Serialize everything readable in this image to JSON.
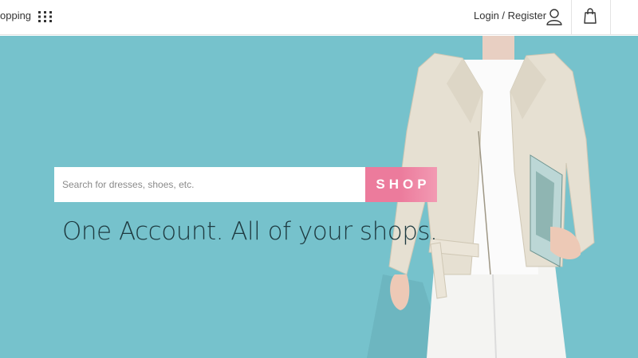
{
  "header": {
    "nav_label": "opping",
    "nav_icon": "grid-icon",
    "login_label": "Login / Register",
    "user_icon": "user-icon",
    "cart_icon": "shopping-bag-icon"
  },
  "hero": {
    "background_color": "#76c2cc",
    "search": {
      "placeholder": "Search for dresses, shoes, etc.",
      "value": ""
    },
    "shop_button_label": "SHOP",
    "shop_button_color": "#ec7b9c",
    "tagline": "One Account. All of your shops."
  }
}
